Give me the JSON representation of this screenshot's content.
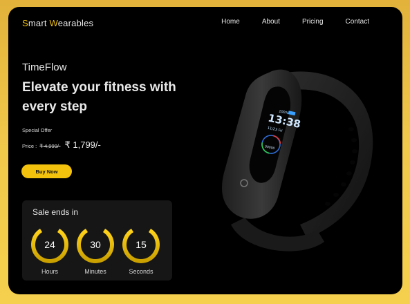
{
  "logo": {
    "first_initial": "S",
    "first_rest": "mart ",
    "second_initial": "W",
    "second_rest": "earables"
  },
  "nav": {
    "items": [
      "Home",
      "About",
      "Pricing",
      "Contact"
    ]
  },
  "hero": {
    "brand": "TimeFlow",
    "headline": "Elevate your fitness with every step",
    "offer_label": "Special Offer",
    "price_label": "Price :",
    "old_price": "₹ 4,999/-",
    "new_price": "₹ 1,799/-",
    "buy_label": "Buy Now"
  },
  "countdown": {
    "title": "Sale ends in",
    "units": [
      {
        "value": "24",
        "label": "Hours"
      },
      {
        "value": "30",
        "label": "Minutes"
      },
      {
        "value": "15",
        "label": "Seconds"
      }
    ]
  },
  "device_screen": {
    "battery": "100%",
    "time": "13:38",
    "date": "11/23 Fri",
    "steps": "00000"
  },
  "colors": {
    "accent": "#f2c20c",
    "page_bg": "#f0c74a",
    "card_bg": "#000000",
    "panel_bg": "#161616"
  }
}
